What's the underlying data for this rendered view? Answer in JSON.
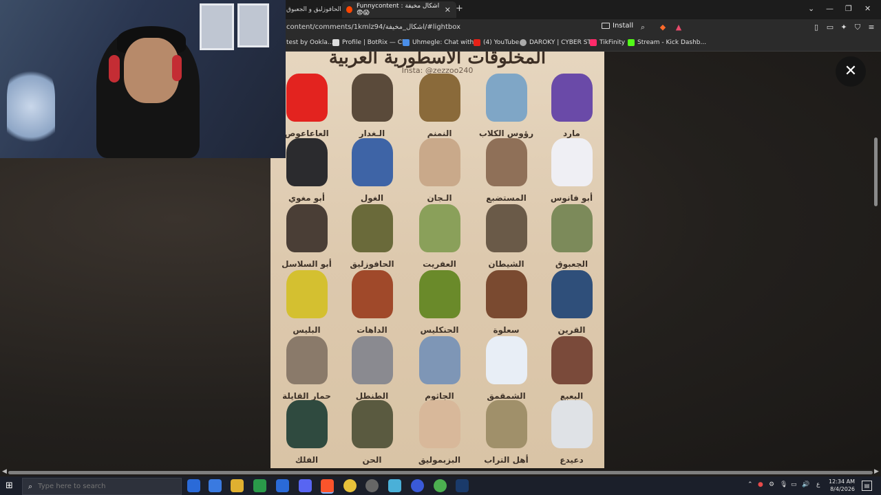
{
  "browser": {
    "tabs": [
      {
        "label": "الحافوزليق و الجعبوق",
        "active": false
      },
      {
        "label": "Funnycontent : اشكال مخيفة 😨😱",
        "active": true
      }
    ],
    "url": "content/comments/1kmlz94/اشكال_مخيفة/#lightbox",
    "install_label": "Install",
    "bookmarks": [
      "test by Ookla...",
      "Profile | BotRix — Cl...",
      "Uhmegle: Chat with...",
      "(4) YouTube",
      "DAROKY | CYBER ST...",
      "TikFinity",
      "Stream - Kick Dashb..."
    ]
  },
  "poster": {
    "title": "المخلوقات الأسطورية العربية",
    "insta": "Insta: @zezzoo240",
    "creatures": [
      {
        "name": "مارد",
        "color": "#6a4aa8"
      },
      {
        "name": "رؤوس الكلاب",
        "color": "#7fa6c6"
      },
      {
        "name": "النمنم",
        "color": "#8a6a3a"
      },
      {
        "name": "الـغدار",
        "color": "#5a4a3a"
      },
      {
        "name": "العاعاعوص",
        "color": "#e3231f"
      },
      {
        "name": "أبو فانوس",
        "color": "#efeff4"
      },
      {
        "name": "المستضبع",
        "color": "#8f7058"
      },
      {
        "name": "الـجان",
        "color": "#c9a98a"
      },
      {
        "name": "الغول",
        "color": "#3e64a6"
      },
      {
        "name": "أبو مغوي",
        "color": "#2b2b2e"
      },
      {
        "name": "الجعبوق",
        "color": "#7c8a5a"
      },
      {
        "name": "الشيطان",
        "color": "#6a5a48"
      },
      {
        "name": "العفريت",
        "color": "#8aa05a"
      },
      {
        "name": "الحافوزليق",
        "color": "#6a6a3a"
      },
      {
        "name": "أبو السلاسل",
        "color": "#4a3e36"
      },
      {
        "name": "القرين",
        "color": "#2f4f7a"
      },
      {
        "name": "سعلوة",
        "color": "#7a4a30"
      },
      {
        "name": "الحنكليس",
        "color": "#6a8a2a"
      },
      {
        "name": "الداهات",
        "color": "#a0492a"
      },
      {
        "name": "البليس",
        "color": "#d4c030"
      },
      {
        "name": "البعبع",
        "color": "#7a4a3a"
      },
      {
        "name": "الشمقمق",
        "color": "#e8eef6"
      },
      {
        "name": "الجاثوم",
        "color": "#7e96b6"
      },
      {
        "name": "الطنطل",
        "color": "#8a8a90"
      },
      {
        "name": "حمار القايلة",
        "color": "#8a7a6a"
      },
      {
        "name": "دعيدع",
        "color": "#dfe2e6"
      },
      {
        "name": "أهل التراب",
        "color": "#a0906a"
      },
      {
        "name": "البزبموليق",
        "color": "#d8b89a"
      },
      {
        "name": "الحن",
        "color": "#5a5a40"
      },
      {
        "name": "الفلك",
        "color": "#2f4a3f"
      }
    ]
  },
  "close_label": "✕",
  "taskbar": {
    "search_placeholder": "Type here to search",
    "time": "12:34 AM",
    "date": "8/4/2026",
    "lang": "ع"
  }
}
